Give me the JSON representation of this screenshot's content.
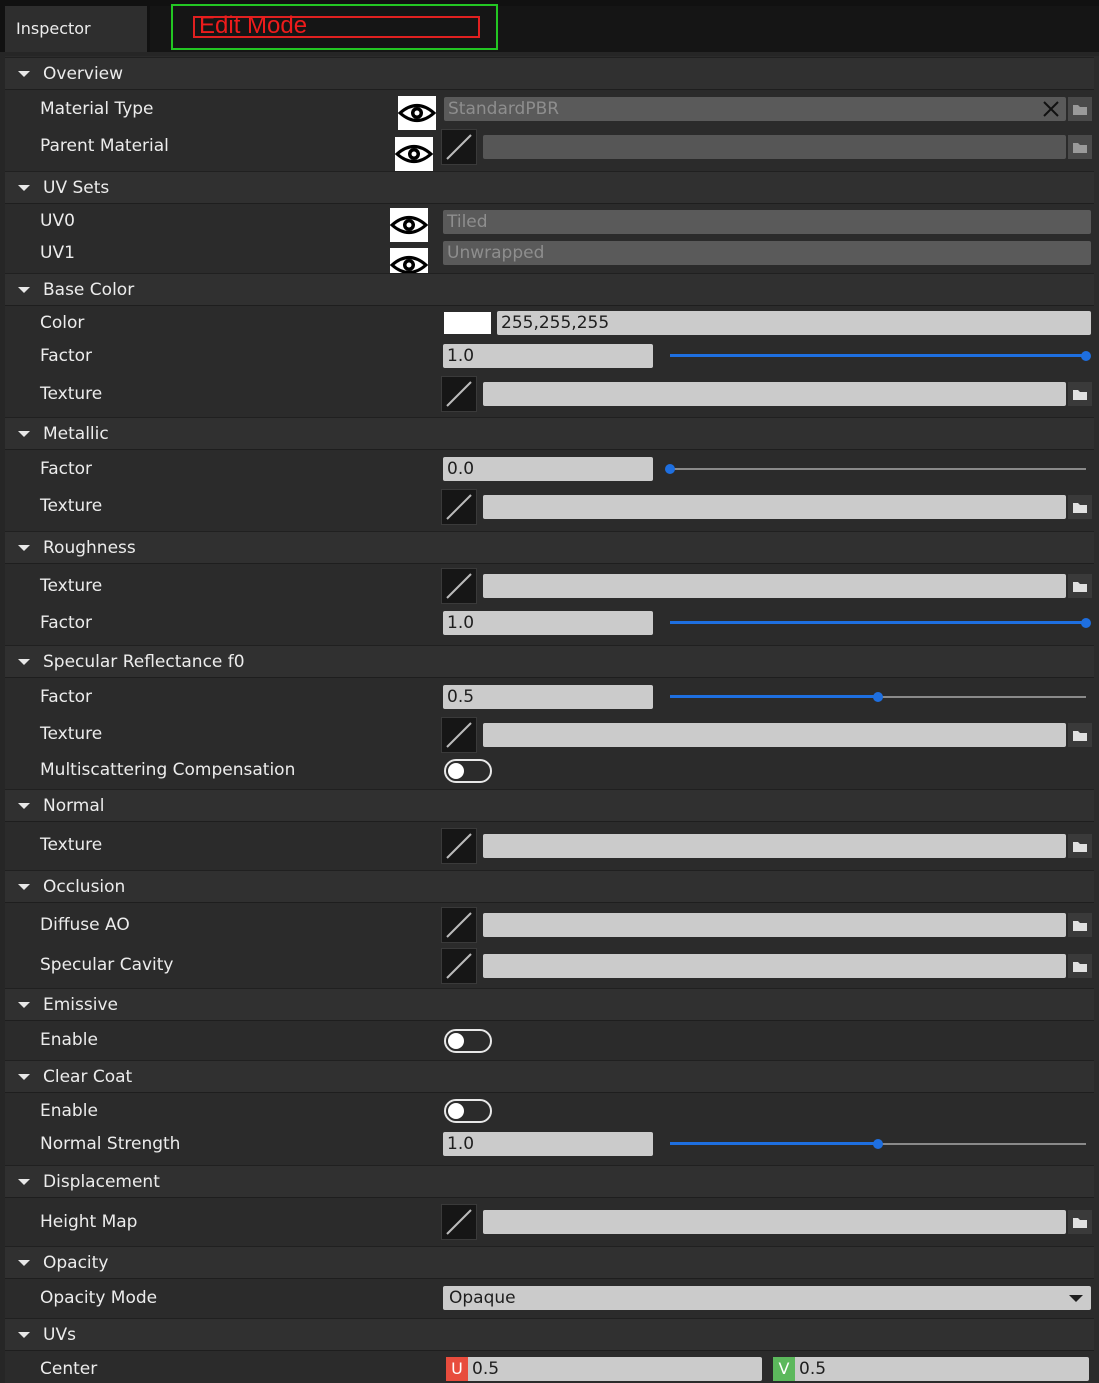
{
  "tab": {
    "inspector": "Inspector",
    "edit_mode": "Edit Mode"
  },
  "colors": {
    "accent": "#1e6fe0",
    "section_bg": "#303030",
    "panel_bg": "#2b2b2b",
    "field_bg": "#cbcbcb",
    "u_tag": "#e84c3d",
    "v_tag": "#5cb85c",
    "highlight_green": "#23c623",
    "highlight_red": "#e02020"
  },
  "overview": {
    "title": "Overview",
    "material_type_label": "Material Type",
    "material_type_value": "StandardPBR",
    "parent_material_label": "Parent Material",
    "parent_material_value": ""
  },
  "uv_sets": {
    "title": "UV Sets",
    "uv0_label": "UV0",
    "uv0_value": "Tiled",
    "uv1_label": "UV1",
    "uv1_value": "Unwrapped"
  },
  "base_color": {
    "title": "Base Color",
    "color_label": "Color",
    "color_value": "255,255,255",
    "factor_label": "Factor",
    "factor_value": "1.0",
    "factor_fraction": 1.0,
    "texture_label": "Texture"
  },
  "metallic": {
    "title": "Metallic",
    "factor_label": "Factor",
    "factor_value": "0.0",
    "factor_fraction": 0.0,
    "texture_label": "Texture"
  },
  "roughness": {
    "title": "Roughness",
    "texture_label": "Texture",
    "factor_label": "Factor",
    "factor_value": "1.0",
    "factor_fraction": 1.0
  },
  "specular": {
    "title": "Specular Reflectance f0",
    "factor_label": "Factor",
    "factor_value": "0.5",
    "factor_fraction": 0.5,
    "texture_label": "Texture",
    "multiscatter_label": "Multiscattering Compensation",
    "multiscatter_on": false
  },
  "normal": {
    "title": "Normal",
    "texture_label": "Texture"
  },
  "occlusion": {
    "title": "Occlusion",
    "diffuse_ao_label": "Diffuse AO",
    "specular_cavity_label": "Specular Cavity"
  },
  "emissive": {
    "title": "Emissive",
    "enable_label": "Enable",
    "enable_on": false
  },
  "clear_coat": {
    "title": "Clear Coat",
    "enable_label": "Enable",
    "enable_on": false,
    "normal_strength_label": "Normal Strength",
    "normal_strength_value": "1.0",
    "normal_strength_fraction": 0.5
  },
  "displacement": {
    "title": "Displacement",
    "height_map_label": "Height Map"
  },
  "opacity": {
    "title": "Opacity",
    "mode_label": "Opacity Mode",
    "mode_value": "Opaque"
  },
  "uvs": {
    "title": "UVs",
    "center_label": "Center",
    "u_tag": "U",
    "u_value": "0.5",
    "v_tag": "V",
    "v_value": "0.5"
  },
  "icons": {
    "eye": "eye-icon",
    "texture": "texture-thumbnail-icon",
    "folder": "folder-icon",
    "clear": "close-icon",
    "collapse": "triangle-down-icon",
    "dropdown": "chevron-down-icon"
  }
}
